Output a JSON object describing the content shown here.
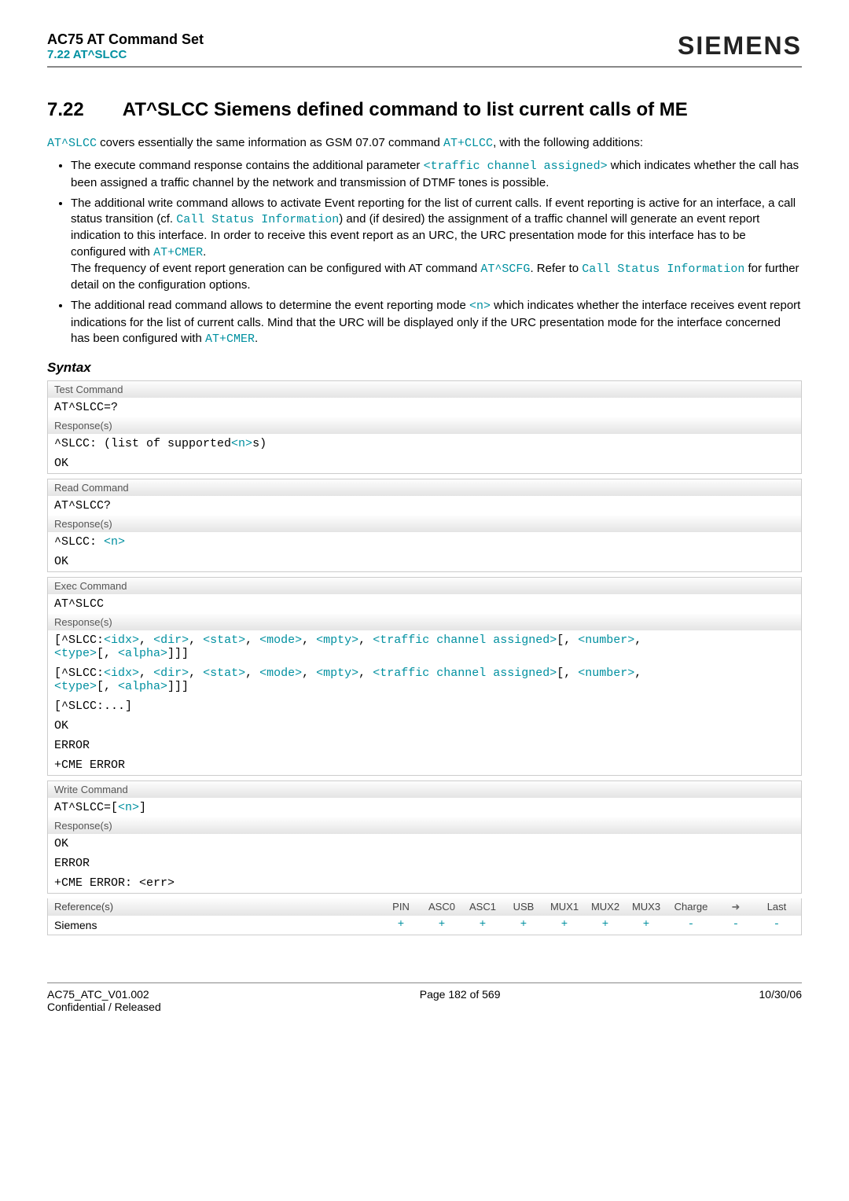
{
  "header": {
    "doc_title": "AC75 AT Command Set",
    "sub_title": "7.22 AT^SLCC",
    "brand": "SIEMENS"
  },
  "section": {
    "number": "7.22",
    "title": "AT^SLCC   Siemens defined command to list current calls of ME"
  },
  "intro": {
    "pre1": "AT^SLCC",
    "text1": " covers essentially the same information as GSM 07.07 command ",
    "cmd1": "AT+CLCC",
    "text2": ", with the following additions:"
  },
  "bullets": {
    "b1a": "The execute command response contains the additional parameter ",
    "b1code": "<traffic channel assigned>",
    "b1b": " which indicates whether the call has been assigned a traffic channel by the network and transmission of DTMF tones is possible.",
    "b2a": "The additional write command allows to activate Event reporting for the list of current calls. If event reporting is active for an interface, a call status transition (cf. ",
    "b2code1": "Call Status Information",
    "b2b": ") and (if desired) the assignment of a traffic channel will generate an event report indication to this interface. In order to receive this event report as an URC, the URC presentation mode for this interface has to be configured with ",
    "b2code2": "AT+CMER",
    "b2c": ".",
    "b2d": "The frequency of event report generation can be configured with AT command ",
    "b2code3": "AT^SCFG",
    "b2e": ". Refer to ",
    "b2code4": "Call Status Information",
    "b2f": " for further detail on the configuration options.",
    "b3a": "The additional read command allows to determine the event reporting mode ",
    "b3code": "<n>",
    "b3b": " which indicates whether the interface receives event report indications for the list of current calls. Mind that the URC will be displayed only if the URC presentation mode for the interface concerned has been configured with ",
    "b3code2": "AT+CMER",
    "b3c": "."
  },
  "syntax_label": "Syntax",
  "bands": {
    "test": "Test Command",
    "read": "Read Command",
    "exec": "Exec Command",
    "write": "Write Command",
    "resp": "Response(s)",
    "refs": "Reference(s)"
  },
  "commands": {
    "test_cmd": "AT^SLCC=?",
    "test_resp_pre": "^SLCC: ",
    "test_resp_mid": "(list of supported",
    "test_resp_n": "<n>",
    "test_resp_post": "s)",
    "ok": "OK",
    "read_cmd": "AT^SLCC?",
    "read_resp_pre": "^SLCC: ",
    "read_resp_n": "<n>",
    "exec_cmd": "AT^SLCC",
    "exec1_open": "[",
    "exec1_tag": "^SLCC:",
    "exec_params1": "<idx>",
    "exec_sep": ", ",
    "exec_params2": "<dir>",
    "exec_params3": "<stat>",
    "exec_params4": "<mode>",
    "exec_params5": "<mpty>",
    "exec_params6": "<traffic channel assigned>",
    "exec_opt_open": "[, ",
    "exec_params7": "<number>",
    "exec_params8": "<type>",
    "exec_params9": "<alpha>",
    "exec_opt_close": "]]]",
    "exec_line3": "[^SLCC:...]",
    "error": "ERROR",
    "cme": "+CME ERROR",
    "write_cmd_pre": "AT^SLCC=[",
    "write_cmd_n": "<n>",
    "write_cmd_post": "]",
    "write_cme": "+CME ERROR: <err>"
  },
  "ref_cols": [
    "PIN",
    "ASC0",
    "ASC1",
    "USB",
    "MUX1",
    "MUX2",
    "MUX3",
    "Charge",
    "➜",
    "Last"
  ],
  "ref_name": "Siemens",
  "ref_vals": [
    "+",
    "+",
    "+",
    "+",
    "+",
    "+",
    "+",
    "-",
    "-",
    "-"
  ],
  "footer": {
    "left1": "AC75_ATC_V01.002",
    "left2": "Confidential / Released",
    "center": "Page 182 of 569",
    "right": "10/30/06"
  }
}
